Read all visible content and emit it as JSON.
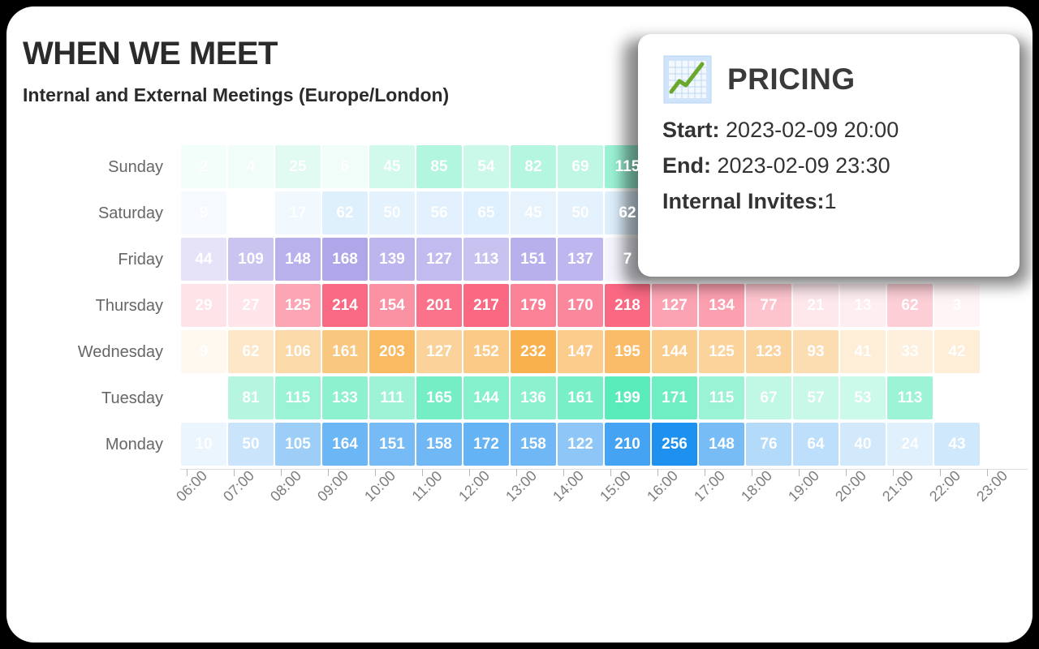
{
  "header": {
    "title": "WHEN WE MEET",
    "subtitle": "Internal and External Meetings (Europe/London)"
  },
  "tooltip": {
    "icon": "chart-increasing-icon",
    "title": "PRICING",
    "start_label": "Start:",
    "start_value": "2023-02-09 20:00",
    "end_label": "End:",
    "end_value": "2023-02-09 23:30",
    "invites_label": "Internal Invites:",
    "invites_value": "1"
  },
  "chart_data": {
    "type": "heatmap",
    "title": "WHEN WE MEET",
    "subtitle": "Internal and External Meetings (Europe/London)",
    "xlabel": "",
    "ylabel": "",
    "x_tick_labels": [
      "06:00",
      "07:00",
      "08:00",
      "09:00",
      "10:00",
      "11:00",
      "12:00",
      "13:00",
      "14:00",
      "15:00",
      "16:00",
      "17:00",
      "18:00",
      "19:00",
      "20:00",
      "21:00",
      "22:00",
      "23:00"
    ],
    "y_tick_labels": [
      "Sunday",
      "Saturday",
      "Friday",
      "Thursday",
      "Wednesday",
      "Tuesday",
      "Monday"
    ],
    "grid": false,
    "legend": "none",
    "row_colors": {
      "Sunday": "#2ee6a8",
      "Saturday": "#8ec8f8",
      "Friday": "#8a7de0",
      "Thursday": "#f94f6d",
      "Wednesday": "#f8a93c",
      "Tuesday": "#2ee6a8",
      "Monday": "#1e90f0"
    },
    "vmax": 256,
    "rows": [
      {
        "day": "Sunday",
        "color": "#2ee6a8",
        "values": [
          2,
          4,
          25,
          6,
          45,
          85,
          54,
          82,
          69,
          115,
          null,
          null,
          null,
          null,
          null,
          null,
          null,
          null
        ]
      },
      {
        "day": "Saturday",
        "color": "#8ec8f8",
        "values": [
          9,
          null,
          17,
          62,
          50,
          56,
          65,
          45,
          50,
          62,
          null,
          null,
          null,
          null,
          null,
          null,
          null,
          null
        ]
      },
      {
        "day": "Friday",
        "color": "#8a7de0",
        "values": [
          44,
          109,
          148,
          168,
          139,
          127,
          113,
          151,
          137,
          7,
          null,
          null,
          null,
          null,
          null,
          null,
          null,
          null
        ]
      },
      {
        "day": "Thursday",
        "color": "#f94f6d",
        "values": [
          29,
          27,
          125,
          214,
          154,
          201,
          217,
          179,
          170,
          218,
          127,
          134,
          77,
          21,
          13,
          62,
          3,
          null
        ]
      },
      {
        "day": "Wednesday",
        "color": "#f8a93c",
        "values": [
          9,
          62,
          106,
          161,
          203,
          127,
          152,
          232,
          147,
          195,
          144,
          125,
          123,
          93,
          41,
          33,
          42,
          null
        ]
      },
      {
        "day": "Tuesday",
        "color": "#2ee6a8",
        "values": [
          null,
          81,
          115,
          133,
          111,
          165,
          144,
          136,
          161,
          199,
          171,
          115,
          67,
          57,
          53,
          113,
          null,
          null
        ]
      },
      {
        "day": "Monday",
        "color": "#1e90f0",
        "values": [
          10,
          50,
          105,
          164,
          151,
          158,
          172,
          158,
          122,
          210,
          256,
          148,
          76,
          64,
          40,
          24,
          43,
          null
        ]
      }
    ]
  }
}
